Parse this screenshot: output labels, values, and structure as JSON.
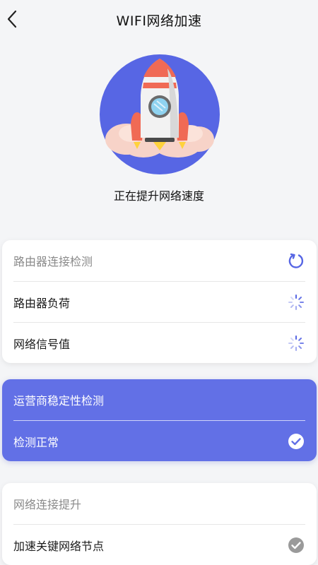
{
  "header": {
    "title": "WIFI网络加速"
  },
  "hero": {
    "status_text": "正在提升网络速度"
  },
  "colors": {
    "accent": "#6270e6",
    "muted": "#8a8a8a",
    "check_gray": "#9a9a9a"
  },
  "cards": [
    {
      "rows": [
        {
          "label": "路由器连接检测",
          "icon": "refresh-icon",
          "state": "header"
        },
        {
          "label": "路由器负荷",
          "icon": "loading-spinner-icon",
          "state": "loading"
        },
        {
          "label": "网络信号值",
          "icon": "loading-spinner-icon",
          "state": "loading"
        }
      ]
    },
    {
      "rows": [
        {
          "label": "运营商稳定性检测",
          "state": "header"
        },
        {
          "label": "检测正常",
          "icon": "check-circle-icon",
          "state": "done"
        }
      ]
    },
    {
      "rows": [
        {
          "label": "网络连接提升",
          "state": "header"
        },
        {
          "label": "加速关键网络节点",
          "icon": "check-circle-icon",
          "state": "pending"
        }
      ]
    }
  ]
}
